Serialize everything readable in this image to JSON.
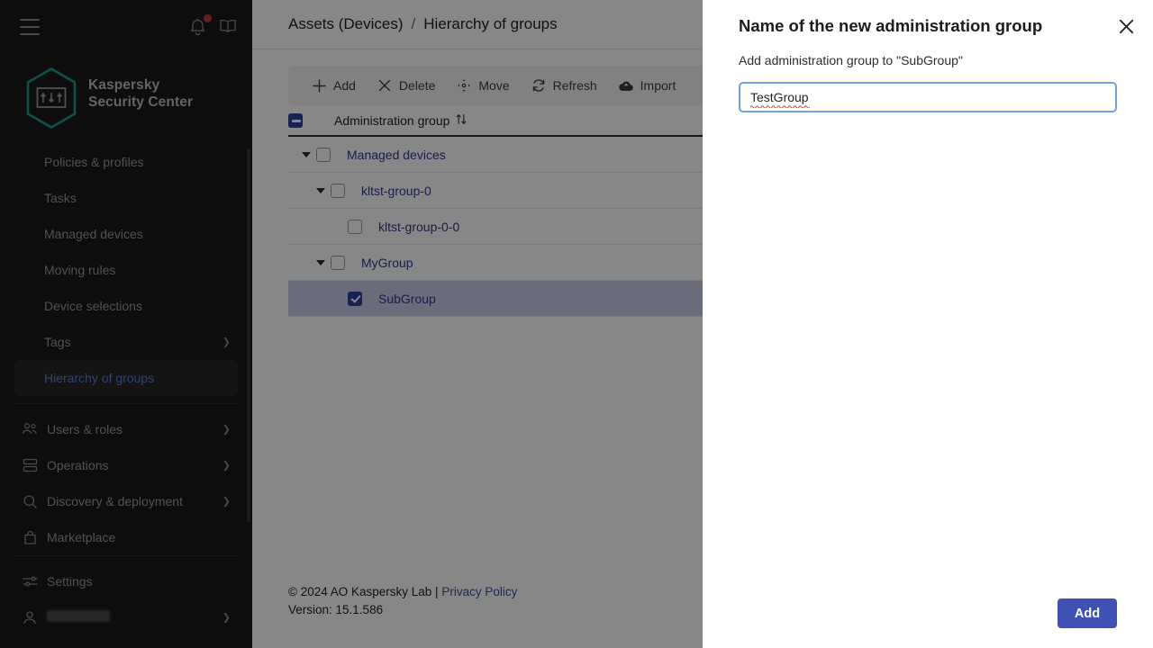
{
  "colors": {
    "sidebar_bg": "#1a1a1a",
    "accent_blue": "#3f51b5",
    "link_blue": "#3a4fa8",
    "logo_teal": "#1b9e8a",
    "selected_row": "#c9cde4",
    "focus_border": "#6fa3e0",
    "notification_dot": "#b83b3b"
  },
  "sidebar": {
    "hamburger_icon": "hamburger-menu-icon",
    "bell_icon": "notification-bell-icon",
    "book_icon": "help-book-icon",
    "logo": {
      "icon": "kaspersky-hexagon-logo",
      "line1": "Kaspersky",
      "line2": "Security Center"
    },
    "items": [
      {
        "label": "Policies & profiles",
        "icon": null,
        "chevron": false,
        "active": false
      },
      {
        "label": "Tasks",
        "icon": null,
        "chevron": false,
        "active": false
      },
      {
        "label": "Managed devices",
        "icon": null,
        "chevron": false,
        "active": false
      },
      {
        "label": "Moving rules",
        "icon": null,
        "chevron": false,
        "active": false
      },
      {
        "label": "Device selections",
        "icon": null,
        "chevron": false,
        "active": false
      },
      {
        "label": "Tags",
        "icon": null,
        "chevron": true,
        "active": false
      },
      {
        "label": "Hierarchy of groups",
        "icon": null,
        "chevron": false,
        "active": true
      }
    ],
    "items2": [
      {
        "label": "Users & roles",
        "icon": "users-icon",
        "chevron": true
      },
      {
        "label": "Operations",
        "icon": "operations-icon",
        "chevron": true
      },
      {
        "label": "Discovery & deployment",
        "icon": "search-icon",
        "chevron": true
      },
      {
        "label": "Marketplace",
        "icon": "marketplace-bag-icon",
        "chevron": false
      }
    ],
    "items3": [
      {
        "label": "Settings",
        "icon": "settings-sliders-icon",
        "chevron": false
      },
      {
        "label": "",
        "icon": "user-account-icon",
        "chevron": true,
        "redacted": true
      }
    ]
  },
  "breadcrumb": {
    "root": "Assets (Devices)",
    "separator": "/",
    "current": "Hierarchy of groups"
  },
  "toolbar": {
    "buttons": [
      {
        "label": "Add",
        "icon": "plus-icon"
      },
      {
        "label": "Delete",
        "icon": "close-x-icon"
      },
      {
        "label": "Move",
        "icon": "move-icon"
      },
      {
        "label": "Refresh",
        "icon": "refresh-icon"
      },
      {
        "label": "Import",
        "icon": "cloud-upload-icon"
      }
    ]
  },
  "table": {
    "header_checkbox_state": "indeterminate",
    "column_header": "Administration group",
    "sort_icon": "sort-updown-icon",
    "rows": [
      {
        "label": "Managed devices",
        "indent": 0,
        "expandable": true,
        "checked": false,
        "selected": false
      },
      {
        "label": "kltst-group-0",
        "indent": 1,
        "expandable": true,
        "checked": false,
        "selected": false
      },
      {
        "label": "kltst-group-0-0",
        "indent": 2,
        "expandable": false,
        "checked": false,
        "selected": false
      },
      {
        "label": "MyGroup",
        "indent": 1,
        "expandable": true,
        "checked": false,
        "selected": false
      },
      {
        "label": "SubGroup",
        "indent": 2,
        "expandable": false,
        "checked": true,
        "selected": true
      }
    ]
  },
  "footer": {
    "copyright": "© 2024 AO Kaspersky Lab |",
    "privacy_link": "Privacy Policy",
    "version": "Version: 15.1.586"
  },
  "dialog": {
    "title": "Name of the new administration group",
    "close_icon": "close-x-icon",
    "subtitle": "Add administration group to \"SubGroup\"",
    "input_value": "TestGroup",
    "input_placeholder": "",
    "add_button": "Add"
  }
}
